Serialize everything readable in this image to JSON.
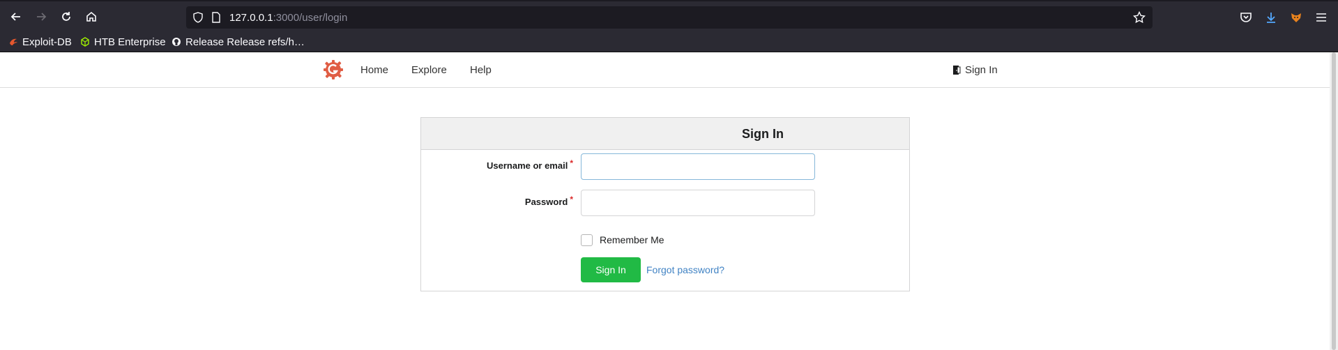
{
  "browser": {
    "url_host": "127.0.0.1",
    "url_path": ":3000/user/login",
    "bookmarks": [
      {
        "label": "Exploit-DB",
        "icon": "exploitdb-icon"
      },
      {
        "label": "HTB Enterprise",
        "icon": "htb-cube-icon"
      },
      {
        "label": "Release Release refs/h…",
        "icon": "github-icon"
      }
    ]
  },
  "nav": {
    "links": [
      "Home",
      "Explore",
      "Help"
    ],
    "sign_in": "Sign In"
  },
  "login": {
    "title": "Sign In",
    "username_label": "Username or email",
    "password_label": "Password",
    "required_mark": "*",
    "username_value": "",
    "password_value": "",
    "remember_me": "Remember Me",
    "remember_checked": false,
    "submit": "Sign In",
    "forgot": "Forgot password?"
  },
  "colors": {
    "primary_button": "#21ba45",
    "link": "#4183c4",
    "required": "#db2828",
    "logo": "#e05d44"
  }
}
